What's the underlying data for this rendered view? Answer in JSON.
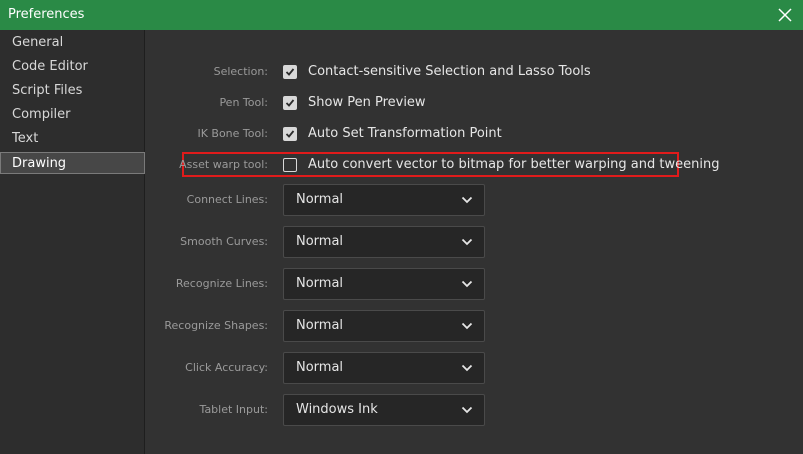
{
  "window": {
    "title": "Preferences"
  },
  "sidebar": {
    "items": [
      {
        "label": "General"
      },
      {
        "label": "Code Editor"
      },
      {
        "label": "Script Files"
      },
      {
        "label": "Compiler"
      },
      {
        "label": "Text"
      },
      {
        "label": "Drawing",
        "selected": true
      }
    ]
  },
  "drawing": {
    "checkboxes": [
      {
        "label": "Selection:",
        "text": "Contact-sensitive Selection and Lasso Tools",
        "checked": true
      },
      {
        "label": "Pen Tool:",
        "text": "Show Pen Preview",
        "checked": true
      },
      {
        "label": "IK Bone Tool:",
        "text": "Auto Set Transformation Point",
        "checked": true
      },
      {
        "label": "Asset warp tool:",
        "text": "Auto convert vector to bitmap for better warping and tweening",
        "checked": false
      }
    ],
    "dropdowns": [
      {
        "label": "Connect Lines:",
        "value": "Normal"
      },
      {
        "label": "Smooth Curves:",
        "value": "Normal"
      },
      {
        "label": "Recognize Lines:",
        "value": "Normal"
      },
      {
        "label": "Recognize Shapes:",
        "value": "Normal"
      },
      {
        "label": "Click Accuracy:",
        "value": "Normal"
      },
      {
        "label": "Tablet Input:",
        "value": "Windows Ink"
      }
    ]
  },
  "colors": {
    "titlebar": "#2a8a46",
    "highlight_border": "#e01b1b"
  }
}
